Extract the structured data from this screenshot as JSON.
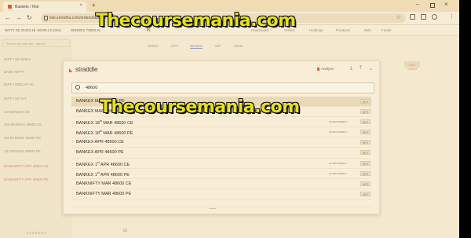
{
  "browser": {
    "tab_title": "Baskets / Kite",
    "tab_close": "×",
    "new_tab": "+",
    "url": "kite.zerodha.com/orders/baskets",
    "win_min": "–",
    "win_close": "×",
    "back": "←",
    "forward": "→",
    "reload": "↻"
  },
  "app_header": {
    "indices": [
      {
        "label": "NIFTY 50",
        "value": "22423.15",
        "change": "-50.80 (-0.23%)"
      },
      {
        "label": "SENSEX",
        "value": "73903.91",
        "change": ""
      }
    ],
    "logo": "K",
    "nav": [
      "Dashboard",
      "Orders",
      "Holdings",
      "Positions",
      "Bids",
      "Funds"
    ]
  },
  "sidebar": {
    "search_placeholder": "Search eg: infy bse, nifty fut, ...",
    "rows": [
      {
        "label": "NIFTY 50 INDEX",
        "red": false
      },
      {
        "label": "BANK NIFTY",
        "red": false
      },
      {
        "label": "NIFTY MIDCAP 50",
        "red": false
      },
      {
        "label": "NIFTY 50 FUT",
        "red": false
      },
      {
        "label": "1st SENSEX CE",
        "red": false
      },
      {
        "label": "2nd BANKEX 48600 CE",
        "red": false
      },
      {
        "label": "3rd BANKEX 48600 PE",
        "red": false
      },
      {
        "label": "4th SENSEX 48600 PE",
        "red": false
      },
      {
        "label": "BANKNIFTY APR 48600 CE",
        "red": true
      },
      {
        "label": "BANKNIFTY APR 48600 PE",
        "red": true
      }
    ],
    "tabs": "1  2  3  4  5  6  7"
  },
  "pane": {
    "tabs": [
      "Orders",
      "GTT",
      "Baskets",
      "SIP",
      "Alerts"
    ],
    "active_tab": "Baskets",
    "action_button": "New basket"
  },
  "modal": {
    "title": "straddle",
    "analyse_label": "Analyse",
    "search_value": "48600",
    "results": [
      {
        "name": "BANKEX MAR 48600 PE",
        "sup": "",
        "name_after": "",
        "weekly": "",
        "badge": "BFO",
        "selected": true
      },
      {
        "name": "BANKEX MAR 48600 CE",
        "sup": "",
        "name_after": "",
        "weekly": "",
        "badge": "BFO",
        "selected": false
      },
      {
        "name": "BANKEX 18",
        "sup": "th",
        "name_after": " MAR 48600 CE",
        "weekly": "18 MAR WEEKLY",
        "badge": "BFO",
        "selected": false
      },
      {
        "name": "BANKEX 18",
        "sup": "th",
        "name_after": " MAR 48600 PE",
        "weekly": "18 MAR WEEKLY",
        "badge": "BFO",
        "selected": false
      },
      {
        "name": "BANKEX APR 48600 CE",
        "sup": "",
        "name_after": "",
        "weekly": "",
        "badge": "BFO",
        "selected": false
      },
      {
        "name": "BANKEX APR 48600 PE",
        "sup": "",
        "name_after": "",
        "weekly": "",
        "badge": "BFO",
        "selected": false
      },
      {
        "name": "BANKEX 1",
        "sup": "st",
        "name_after": " APR 48600 CE",
        "weekly": "01 APR WEEKLY",
        "badge": "BFO",
        "selected": false
      },
      {
        "name": "BANKEX 1",
        "sup": "st",
        "name_after": " APR 48600 PE",
        "weekly": "01 APR WEEKLY",
        "badge": "BFO",
        "selected": false
      },
      {
        "name": "BANKNIFTY MAR 48600 CE",
        "sup": "",
        "name_after": "",
        "weekly": "",
        "badge": "NFO",
        "selected": false
      },
      {
        "name": "BANKNIFTY MAR 48600 PE",
        "sup": "",
        "name_after": "",
        "weekly": "",
        "badge": "NFO",
        "selected": false
      }
    ]
  },
  "watermarks": [
    "Thecoursemania.com",
    "Thecoursemania.com"
  ]
}
